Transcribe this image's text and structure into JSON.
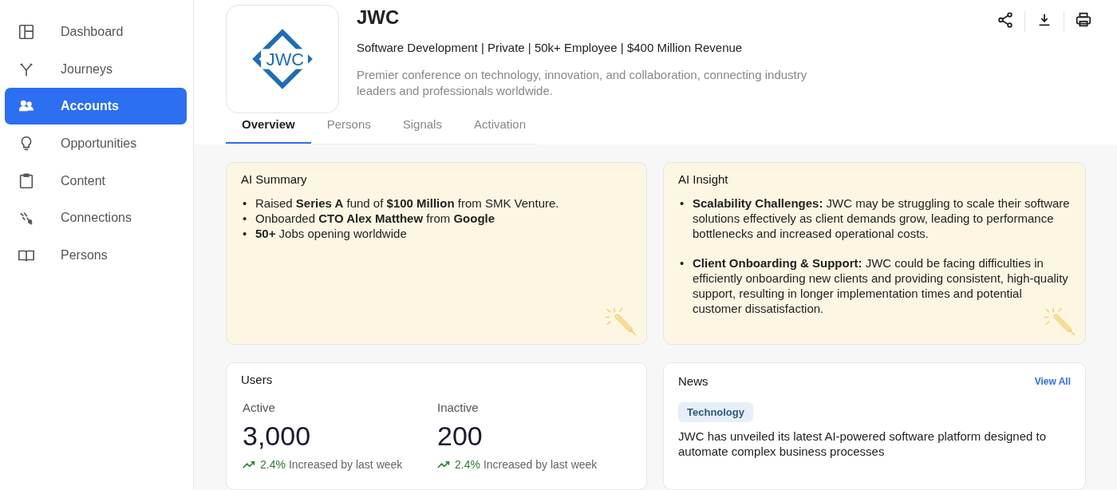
{
  "sidebar": {
    "items": [
      {
        "label": "Dashboard",
        "selected": false
      },
      {
        "label": "Journeys",
        "selected": false
      },
      {
        "label": "Accounts",
        "selected": true
      },
      {
        "label": "Opportunities",
        "selected": false
      },
      {
        "label": "Content",
        "selected": false
      },
      {
        "label": "Connections",
        "selected": false
      },
      {
        "label": "Persons",
        "selected": false
      }
    ]
  },
  "company": {
    "logo_text": "JWC",
    "name": "JWC",
    "meta": "Software Development | Private | 50k+ Employee | $400 Million Revenue",
    "description": "Premier conference on technology, innovation, and collaboration, connecting industry leaders and professionals worldwide."
  },
  "tabs": [
    {
      "label": "Overview",
      "selected": true
    },
    {
      "label": "Persons",
      "selected": false
    },
    {
      "label": "Signals",
      "selected": false
    },
    {
      "label": "Activation",
      "selected": false
    }
  ],
  "ai_summary": {
    "title": "AI Summary",
    "items": [
      {
        "bullet": "•",
        "text": "Raised **Series A** fund of **$100 Million** from SMK Venture."
      },
      {
        "bullet": "•",
        "text": "Onboarded **CTO Alex Matthew** from **Google**"
      },
      {
        "bullet": "•",
        "text": "**50+** Jobs opening worldwide"
      }
    ]
  },
  "ai_insight": {
    "title": "AI Insight",
    "items": [
      {
        "bullet": "•",
        "text": "**Scalability Challenges:** JWC may be struggling to scale their software solutions effectively as client demands grow, leading to performance bottlenecks and increased operational costs."
      },
      {
        "bullet": "•",
        "text": "**Client Onboarding & Support:** JWC could be facing difficulties in efficiently onboarding new clients and providing consistent, high-quality support, resulting in longer implementation times and potential customer dissatisfaction."
      }
    ]
  },
  "users": {
    "title": "Users",
    "stats": [
      {
        "label": "Active",
        "value": "3,000",
        "change": "2.4%",
        "note": "Increased by last week"
      },
      {
        "label": "Inactive",
        "value": "200",
        "change": "2.4%",
        "note": "Increased by last week"
      }
    ]
  },
  "news": {
    "title": "News",
    "link": "View All",
    "items": [
      {
        "tag": "Technology",
        "headline": "JWC has unveiled its latest AI-powered software platform designed to automate complex business processes"
      }
    ]
  }
}
